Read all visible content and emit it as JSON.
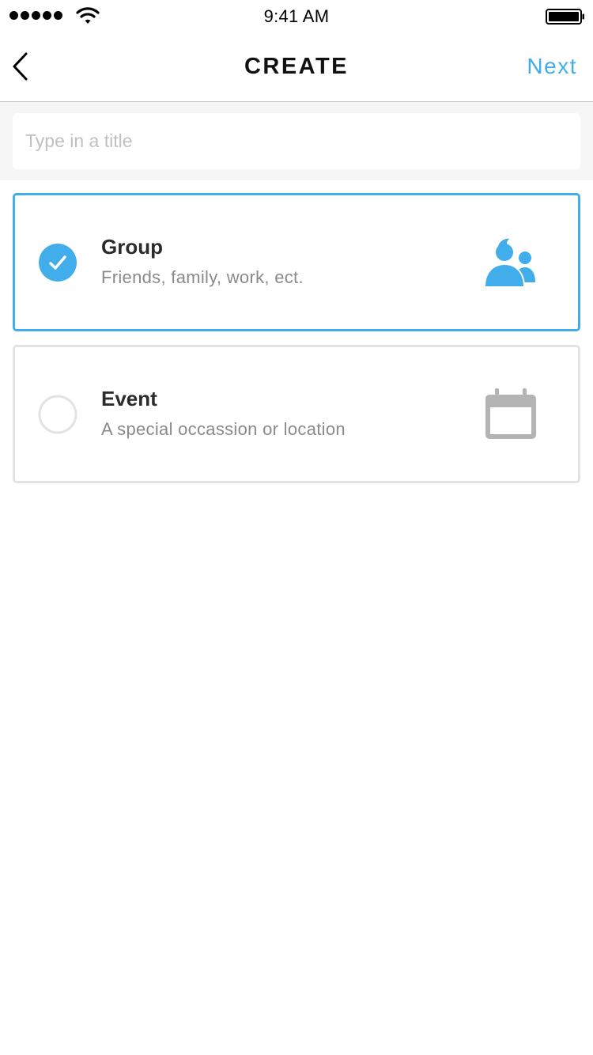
{
  "status_bar": {
    "time": "9:41 AM",
    "signal_icon": "signal-dots-icon",
    "wifi_icon": "wifi-icon",
    "battery_icon": "battery-icon"
  },
  "nav": {
    "back_icon": "chevron-left-icon",
    "title": "CREATE",
    "next_label": "Next"
  },
  "title_field": {
    "placeholder": "Type in a title",
    "value": ""
  },
  "options": [
    {
      "title": "Group",
      "subtitle": "Friends, family, work, ect.",
      "selected": true,
      "icon": "group-people-icon"
    },
    {
      "title": "Event",
      "subtitle": "A special occassion or location",
      "selected": false,
      "icon": "calendar-icon"
    }
  ],
  "colors": {
    "accent": "#41adeb",
    "inactive_border": "#e3e3e3",
    "inactive_icon": "#b4b4b4"
  }
}
